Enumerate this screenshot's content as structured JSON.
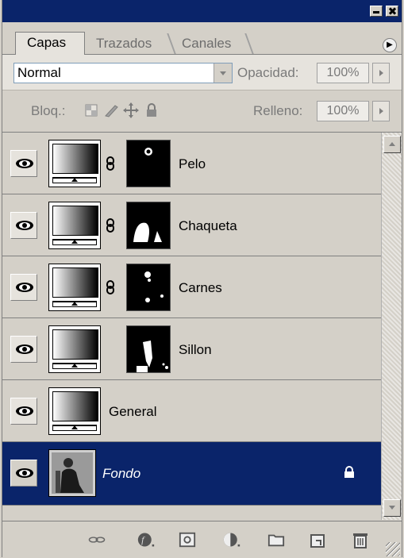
{
  "panel": {
    "tabs": [
      {
        "label": "Capas",
        "active": true
      },
      {
        "label": "Trazados",
        "active": false
      },
      {
        "label": "Canales",
        "active": false
      }
    ]
  },
  "options": {
    "blend_mode": "Normal",
    "opacity_label": "Opacidad:",
    "opacity_value": "100%",
    "lock_label": "Bloq.:",
    "fill_label": "Relleno:",
    "fill_value": "100%"
  },
  "layers": [
    {
      "name": "Pelo",
      "type": "adjustment",
      "has_mask": true,
      "linked": true,
      "visible": true,
      "selected": false
    },
    {
      "name": "Chaqueta",
      "type": "adjustment",
      "has_mask": true,
      "linked": true,
      "visible": true,
      "selected": false
    },
    {
      "name": "Carnes",
      "type": "adjustment",
      "has_mask": true,
      "linked": true,
      "visible": true,
      "selected": false
    },
    {
      "name": "Sillon",
      "type": "adjustment",
      "has_mask": true,
      "linked": false,
      "visible": true,
      "selected": false
    },
    {
      "name": "General",
      "type": "adjustment",
      "has_mask": false,
      "linked": false,
      "visible": true,
      "selected": false
    },
    {
      "name": "Fondo",
      "type": "background",
      "has_mask": false,
      "linked": false,
      "visible": true,
      "selected": true,
      "locked": true
    }
  ],
  "colors": {
    "selection": "#0a246a",
    "panel_bg": "#d4d0c8",
    "titlebar": "#0a246a"
  },
  "icons": {
    "bottom_bar": [
      "link-layers-icon",
      "layer-style-icon",
      "add-mask-icon",
      "adjustment-layer-icon",
      "new-group-icon",
      "new-layer-icon",
      "delete-layer-icon"
    ]
  }
}
